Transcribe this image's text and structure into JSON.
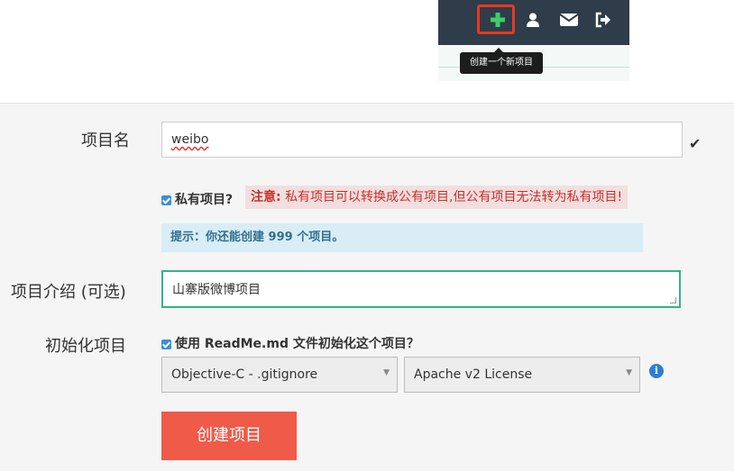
{
  "header": {
    "tooltip": "创建一个新项目",
    "icons": [
      "plus-icon",
      "user-icon",
      "envelope-icon",
      "sign-out-icon"
    ],
    "colors": {
      "bar": "#2f3c4a",
      "plus": "#3ccf6a",
      "highlight": "#e8381e"
    }
  },
  "form": {
    "name_label": "项目名",
    "name_value": "weibo",
    "private_label": "私有项目?",
    "private_warning_prefix": "注意:",
    "private_warning_text": "私有项目可以转换成公有项目,但公有项目无法转为私有项目!",
    "hint": "提示：你还能创建 999 个项目。",
    "desc_label": "项目介绍 (可选)",
    "desc_value": "山寨版微博项目",
    "init_label": "初始化项目",
    "init_checkbox_label": "使用 ReadMe.md 文件初始化这个项目？",
    "gitignore_selected": "Objective-C - .gitignore",
    "license_selected": "Apache v2 License",
    "submit_label": "创建项目"
  }
}
